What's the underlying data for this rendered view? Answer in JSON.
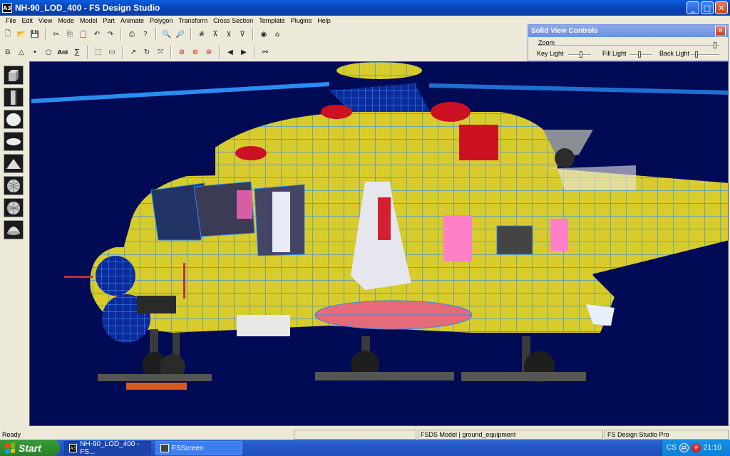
{
  "window": {
    "icon_label": "A3",
    "title": "NH-90_LOD_400 - FS Design Studio",
    "minimize": "_",
    "maximize": "□",
    "close": "✕"
  },
  "menu": [
    "File",
    "Edit",
    "View",
    "Mode",
    "Model",
    "Part",
    "Animate",
    "Polygon",
    "Transform",
    "Cross Section",
    "Template",
    "Plugins",
    "Help"
  ],
  "toolbar": {
    "ani_label": "Ani",
    "sum_label": "∑"
  },
  "solid_view_controls": {
    "title": "Solid View Controls",
    "close": "✕",
    "zoom_label": "Zoom",
    "key_light_label": "Key Light",
    "fill_light_label": "Fill Light",
    "back_light_label": "Back Light"
  },
  "statusbar": {
    "ready": "Ready",
    "model_info": "FSDS Model | ground_equipment",
    "product": "FS Design Studio Pro"
  },
  "taskbar": {
    "start": "Start",
    "tasks": [
      {
        "label": "NH-90_LOD_400 - FS...",
        "icon": "A3"
      },
      {
        "label": "FSScreen",
        "icon": ""
      }
    ],
    "lang": "CS",
    "clock": "21:10"
  },
  "colors": {
    "viewport_bg": "#000a55",
    "fuselage": "#d9cc2a",
    "wireframe": "#2a8df0"
  }
}
